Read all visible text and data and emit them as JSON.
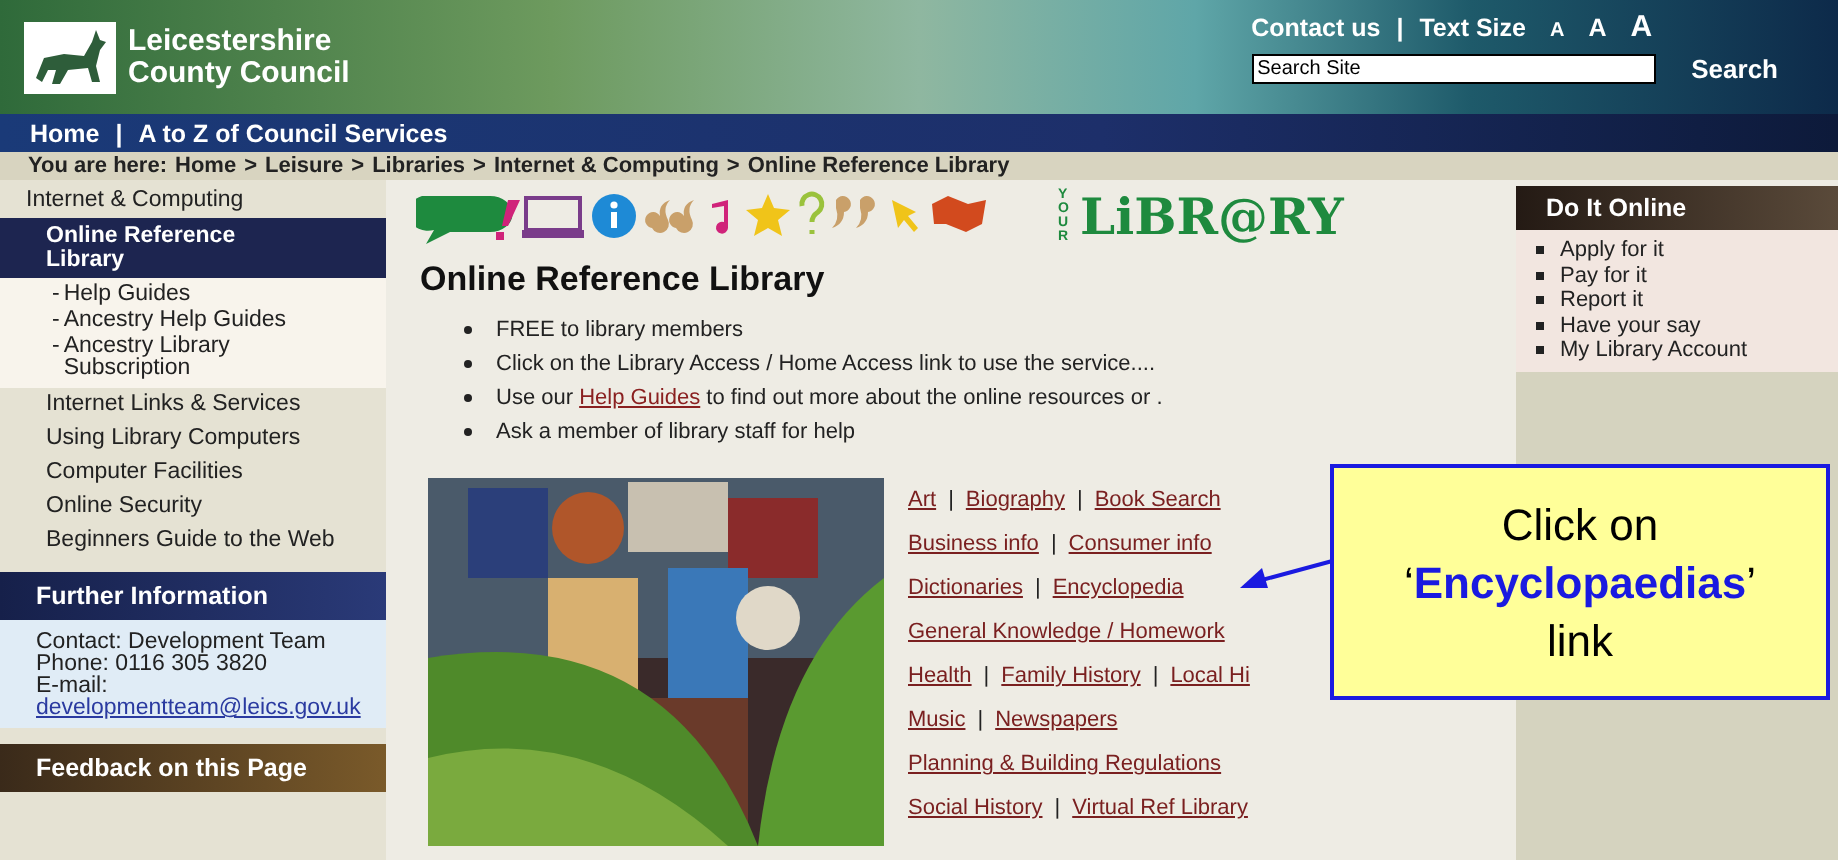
{
  "header": {
    "org_name": [
      "Leicestershire",
      "County Council"
    ],
    "contact": "Contact us",
    "separator": "|",
    "text_size_label": "Text Size",
    "text_sizes": [
      "A",
      "A",
      "A"
    ],
    "search": {
      "value": "Search Site",
      "button": "Search"
    }
  },
  "nav": {
    "separator": "|",
    "links": [
      "Home",
      "A to Z of Council Services"
    ]
  },
  "breadcrumb": {
    "label": "You are here:",
    "separator": ">",
    "trail": [
      "Home",
      "Leisure",
      "Libraries",
      "Internet & Computing",
      "Online Reference Library"
    ]
  },
  "sidebar": {
    "section": "Internet & Computing",
    "items": [
      {
        "label": "Online Reference Library",
        "selected": true,
        "child_marker": "-",
        "children": [
          {
            "label": "Help Guides"
          },
          {
            "label": "Ancestry Help Guides"
          },
          {
            "label": "Ancestry Library Subscription"
          }
        ]
      },
      {
        "label": "Internet Links & Services",
        "selected": false
      },
      {
        "label": "Using Library Computers",
        "selected": false
      },
      {
        "label": "Computer Facilities",
        "selected": false
      },
      {
        "label": "Online Security",
        "selected": false
      },
      {
        "label": "Beginners Guide to the Web",
        "selected": false
      }
    ]
  },
  "further_info": {
    "title": "Further Information",
    "lines": [
      "Contact: Development Team",
      "Phone: 0116 305 3820",
      "E-mail:"
    ],
    "email": "developmentteam@leics.gov.uk"
  },
  "feedback": {
    "title": "Feedback on this Page"
  },
  "banner": {
    "small": "YOUR",
    "logo": "LiBR@RY"
  },
  "main": {
    "title": "Online Reference Library",
    "bullets": [
      {
        "parts": [
          {
            "kind": "text",
            "text": "FREE to library members"
          }
        ]
      },
      {
        "parts": [
          {
            "kind": "text",
            "text": "Click on the Library Access / Home Access link to use the service...."
          }
        ]
      },
      {
        "parts": [
          {
            "kind": "text",
            "text": "Use our "
          },
          {
            "kind": "link",
            "text": "Help Guides"
          },
          {
            "kind": "text",
            "text": " to find out more about the online resources or ."
          }
        ]
      },
      {
        "parts": [
          {
            "kind": "text",
            "text": "Ask a member of library staff for help"
          }
        ]
      }
    ],
    "link_separator": "|",
    "link_rows": [
      [
        "Art",
        "Biography",
        "Book Search"
      ],
      [
        "Business info",
        "Consumer info"
      ],
      [
        "Dictionaries",
        "Encyclopedia"
      ],
      [
        "General Knowledge / Homework"
      ],
      [
        "Health",
        "Family History",
        "Local Hi"
      ],
      [
        "Music",
        "Newspapers"
      ],
      [
        "Planning & Building Regulations"
      ],
      [
        "Social History",
        "Virtual Ref Library"
      ]
    ]
  },
  "do_it_online": {
    "title": "Do It Online",
    "items": [
      "Apply for it",
      "Pay for it",
      "Report it",
      "Have your say",
      "My Library Account"
    ]
  },
  "callout": {
    "lines": [
      "Click on",
      "‘**Encyclopaedias**’",
      "link"
    ]
  }
}
